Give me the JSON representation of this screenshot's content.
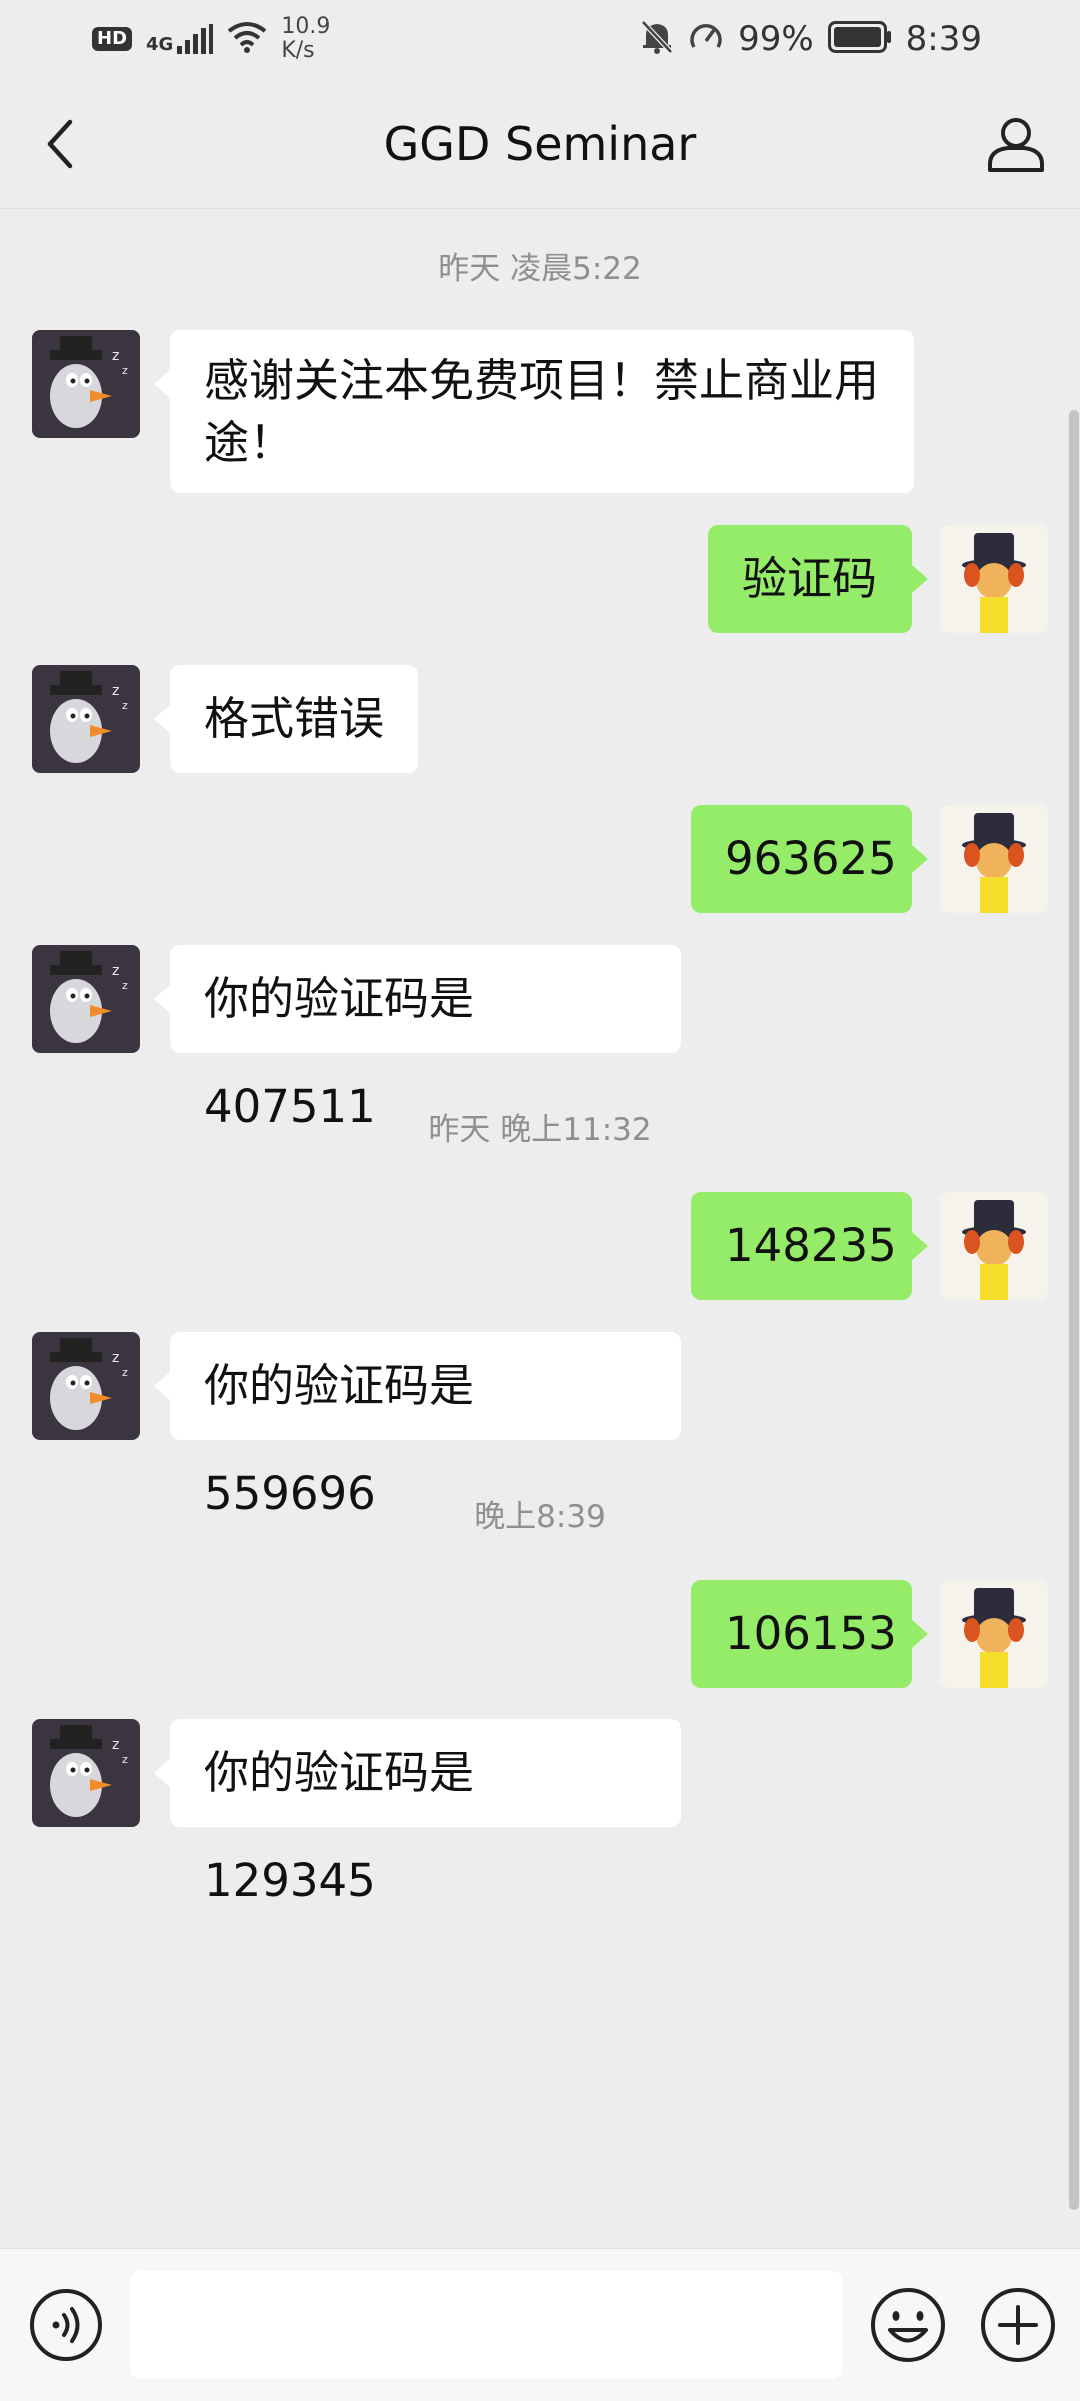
{
  "status_bar": {
    "hd": "HD",
    "network": "4G",
    "speed_value": "10.9",
    "speed_unit": "K/s",
    "battery_percent": "99%",
    "time": "8:39"
  },
  "header": {
    "title": "GGD Seminar"
  },
  "messages": [
    {
      "type": "time",
      "text": "昨天 凌晨5:22"
    },
    {
      "type": "incoming",
      "text_line1": "感谢关注本免费项目！禁止商业用",
      "text_line2": "途！"
    },
    {
      "type": "outgoing",
      "text": "验证码"
    },
    {
      "type": "incoming",
      "text": "格式错误"
    },
    {
      "type": "outgoing",
      "text": "963625"
    },
    {
      "type": "incoming",
      "text": "你的验证码是 407511"
    },
    {
      "type": "time",
      "text": "昨天 晚上11:32"
    },
    {
      "type": "outgoing",
      "text": "148235"
    },
    {
      "type": "incoming",
      "text": "你的验证码是 559696"
    },
    {
      "type": "time",
      "text": "晚上8:39"
    },
    {
      "type": "outgoing",
      "text": "106153"
    },
    {
      "type": "incoming",
      "text": "你的验证码是 129345"
    }
  ],
  "icons": {
    "back": "chevron-left-icon",
    "profile": "person-icon",
    "voice": "voice-icon",
    "emoji": "smiley-icon",
    "plus": "plus-icon",
    "bot_avatar": "penguin-avatar",
    "user_avatar": "top-hat-avatar"
  },
  "colors": {
    "background": "#ededed",
    "incoming_bubble": "#ffffff",
    "outgoing_bubble": "#95ec69"
  }
}
